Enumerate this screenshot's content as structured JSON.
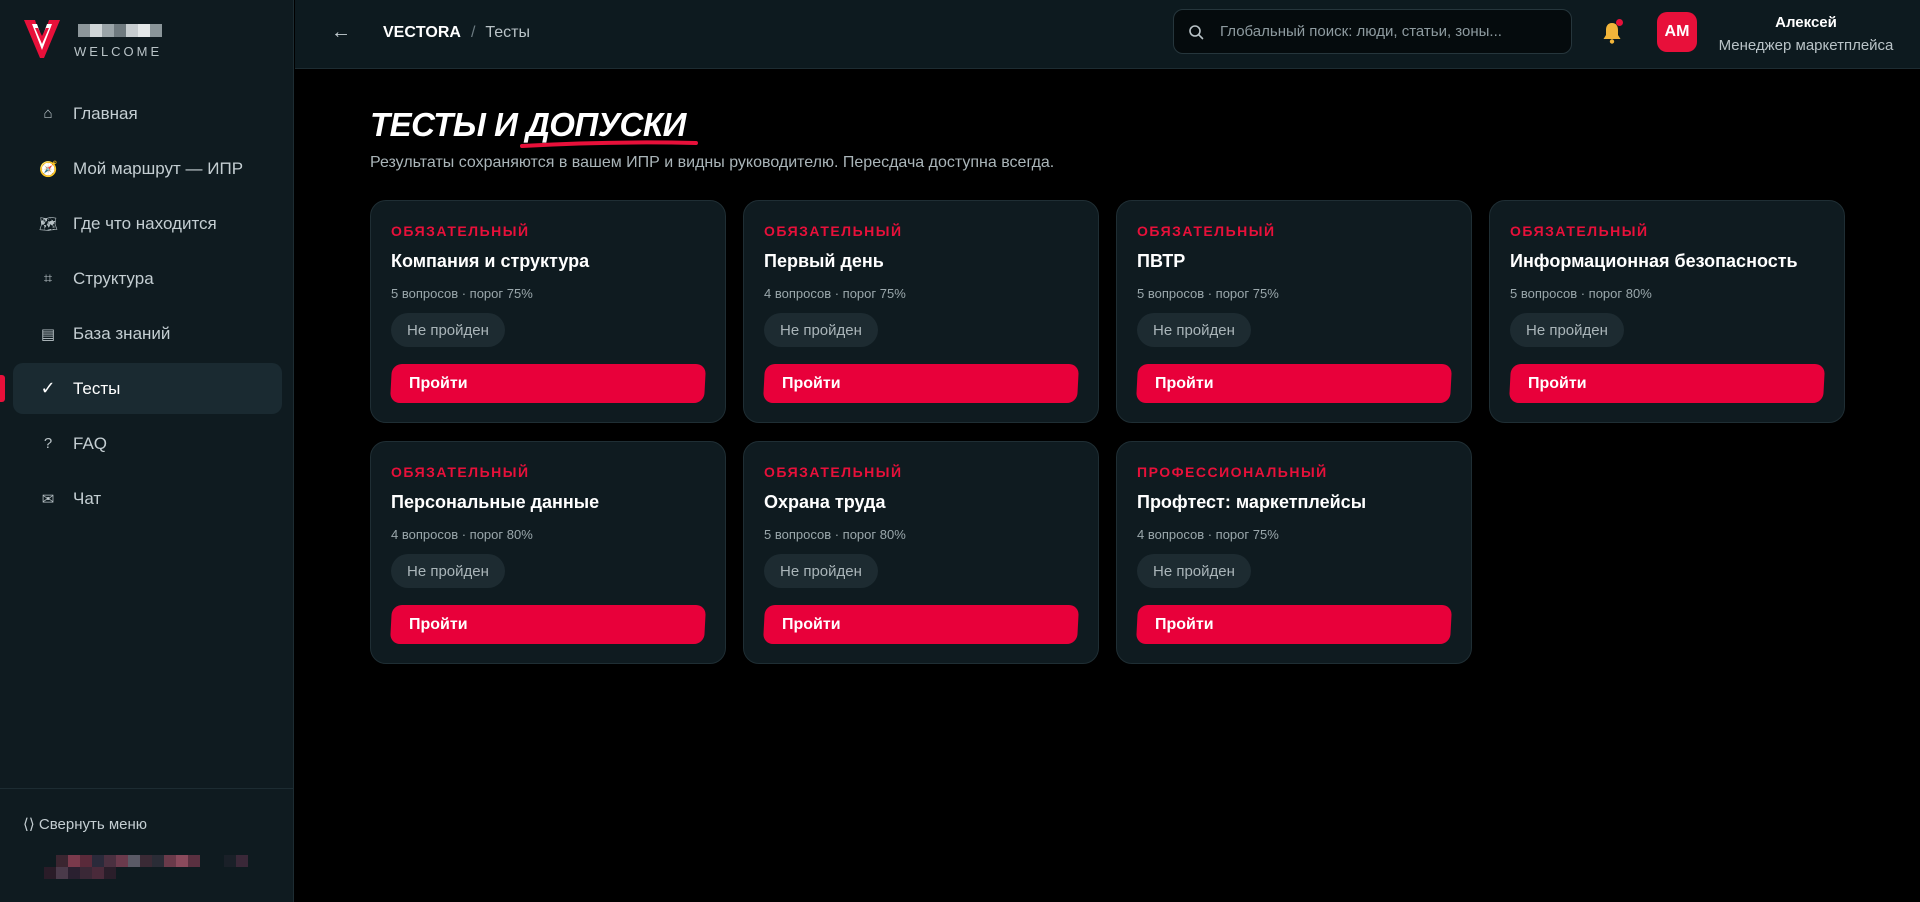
{
  "brand": {
    "welcome": "WELCOME",
    "logo_colors": [
      "#e8103a",
      "#ffffff"
    ]
  },
  "sidebar": {
    "items": [
      {
        "label": "Главная",
        "icon": "home-icon",
        "glyph": "⌂"
      },
      {
        "label": "Мой маршрут — ИПР",
        "icon": "compass-icon",
        "glyph": "🧭"
      },
      {
        "label": "Где что находится",
        "icon": "map-icon",
        "glyph": "🗺"
      },
      {
        "label": "Структура",
        "icon": "grid-icon",
        "glyph": "⌗"
      },
      {
        "label": "База знаний",
        "icon": "book-icon",
        "glyph": "▤"
      },
      {
        "label": "Тесты",
        "icon": "check-icon",
        "glyph": "✓",
        "active": true
      },
      {
        "label": "FAQ",
        "icon": "question-icon",
        "glyph": "?"
      },
      {
        "label": "Чат",
        "icon": "mail-icon",
        "glyph": "✉"
      }
    ],
    "collapse_label": "⟨⟩ Свернуть меню"
  },
  "header": {
    "back_icon": "arrow-left-icon",
    "breadcrumb_root": "VECTORA",
    "breadcrumb_sep": "/",
    "breadcrumb_current": "Тесты",
    "search_placeholder": "Глобальный поиск: люди, статьи, зоны...",
    "notification_icon": "bell-icon",
    "user_initials": "AM",
    "user_name": "Алексей",
    "user_role": "Менеджер маркетплейса"
  },
  "page": {
    "title": "ТЕСТЫ И ДОПУСКИ",
    "subtitle": "Результаты сохраняются в вашем ИПР и видны руководителю. Пересдача доступна всегда."
  },
  "tests": [
    {
      "tag": "ОБЯЗАТЕЛЬНЫЙ",
      "title": "Компания и структура",
      "meta": "5 вопросов · порог 75%",
      "status": "Не пройден",
      "button": "Пройти"
    },
    {
      "tag": "ОБЯЗАТЕЛЬНЫЙ",
      "title": "Первый день",
      "meta": "4 вопросов · порог 75%",
      "status": "Не пройден",
      "button": "Пройти"
    },
    {
      "tag": "ОБЯЗАТЕЛЬНЫЙ",
      "title": "ПВТР",
      "meta": "5 вопросов · порог 75%",
      "status": "Не пройден",
      "button": "Пройти"
    },
    {
      "tag": "ОБЯЗАТЕЛЬНЫЙ",
      "title": "Информационная безопасность",
      "meta": "5 вопросов · порог 80%",
      "status": "Не пройден",
      "button": "Пройти"
    },
    {
      "tag": "ОБЯЗАТЕЛЬНЫЙ",
      "title": "Персональные данные",
      "meta": "4 вопросов · порог 80%",
      "status": "Не пройден",
      "button": "Пройти"
    },
    {
      "tag": "ОБЯЗАТЕЛЬНЫЙ",
      "title": "Охрана труда",
      "meta": "5 вопросов · порог 80%",
      "status": "Не пройден",
      "button": "Пройти"
    },
    {
      "tag": "ПРОФЕССИОНАЛЬНЫЙ",
      "title": "Профтест: маркетплейсы",
      "meta": "4 вопросов · порог 75%",
      "status": "Не пройден",
      "button": "Пройти"
    }
  ],
  "colors": {
    "accent": "#e8103a",
    "background": "#000000",
    "panel": "#0f1b20"
  }
}
